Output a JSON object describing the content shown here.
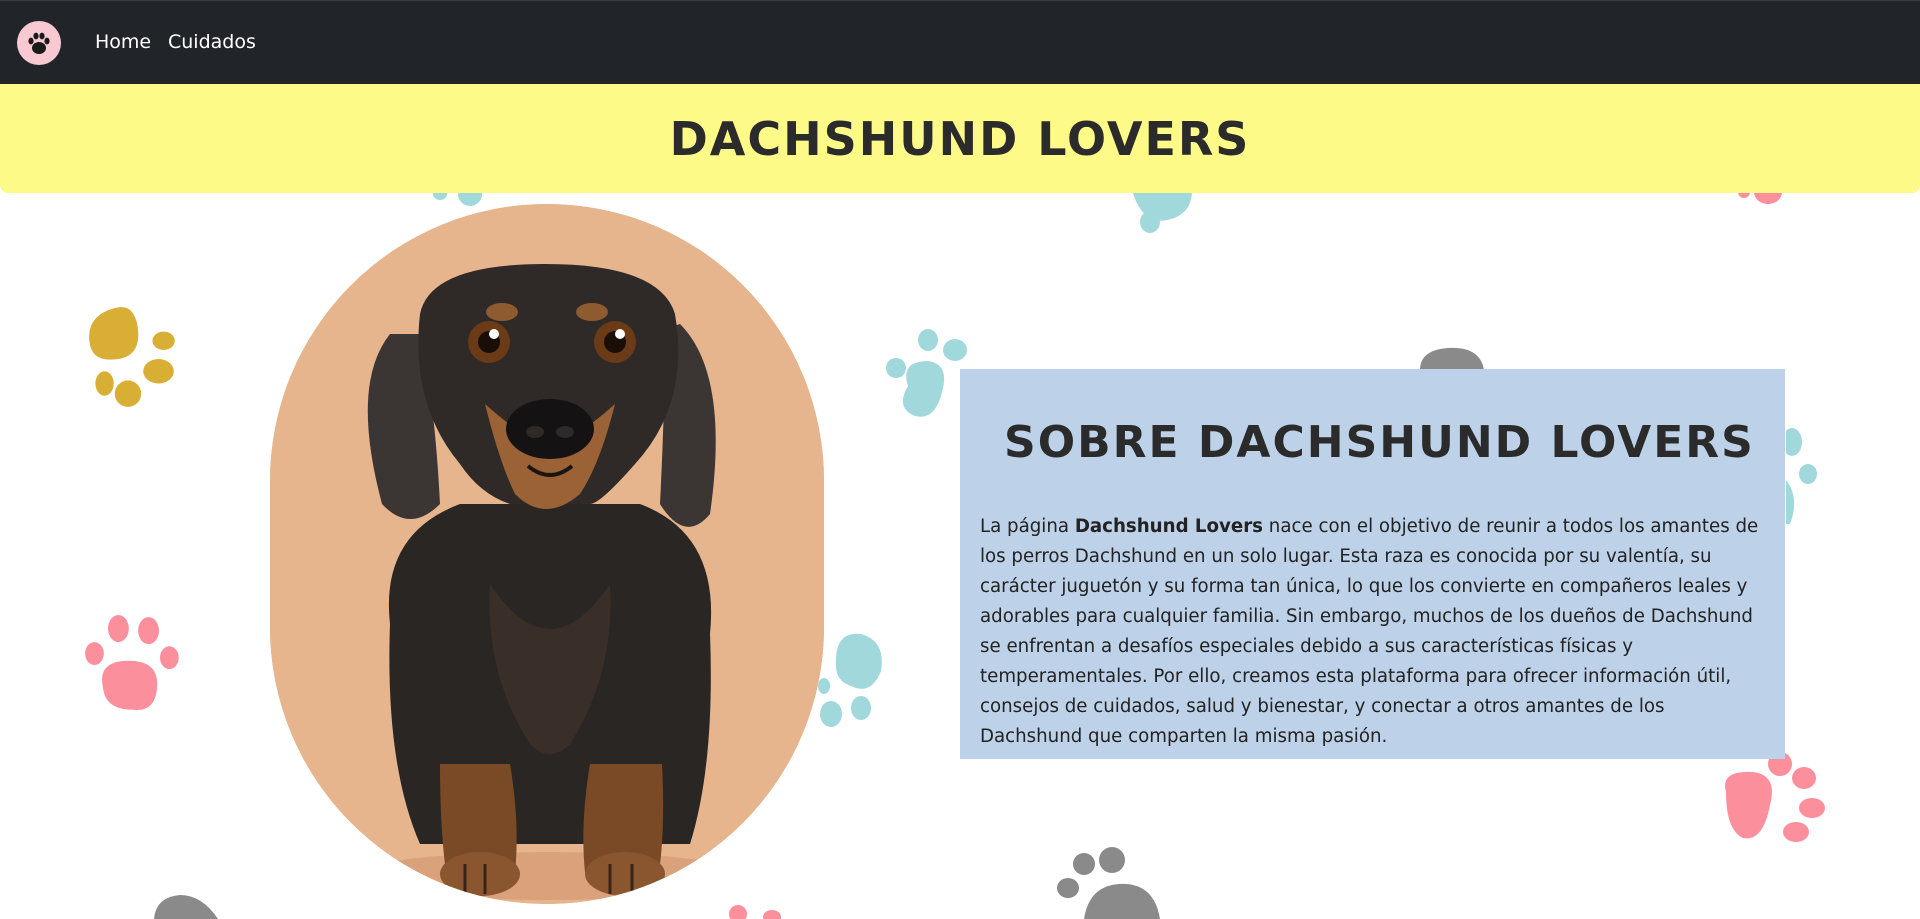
{
  "navbar": {
    "logo_icon": "paw-icon",
    "links": [
      {
        "label": "Home"
      },
      {
        "label": "Cuidados"
      }
    ]
  },
  "banner": {
    "title": "Dachshund Lovers"
  },
  "about": {
    "title": "Sobre Dachshund Lovers",
    "text_before": "La página ",
    "text_bold": "Dachshund Lovers",
    "text_after": " nace con el objetivo de reunir a todos los amantes de los perros Dachshund en un solo lugar. Esta raza es conocida por su valentía, su carácter juguetón y su forma tan única, lo que los convierte en compañeros leales y adorables para cualquier familia. Sin embargo, muchos de los dueños de Dachshund se enfrentan a desafíos especiales debido a sus características físicas y temperamentales. Por ello, creamos esta plataforma para ofrecer información útil, consejos de cuidados, salud y bienestar, y conectar a otros amantes de los Dachshund que comparten la misma pasión."
  },
  "colors": {
    "navbar": "#212529",
    "banner": "#fdfa87",
    "about_box": "#bdd1e8",
    "dog_backdrop": "#e6b48d",
    "paw_yellow": "#d9ae35",
    "paw_pink": "#fb8f9c",
    "paw_teal": "#a1d8dc",
    "paw_gray": "#8a8a8a"
  },
  "icons": [
    "paw-icon",
    "dachshund-photo"
  ]
}
